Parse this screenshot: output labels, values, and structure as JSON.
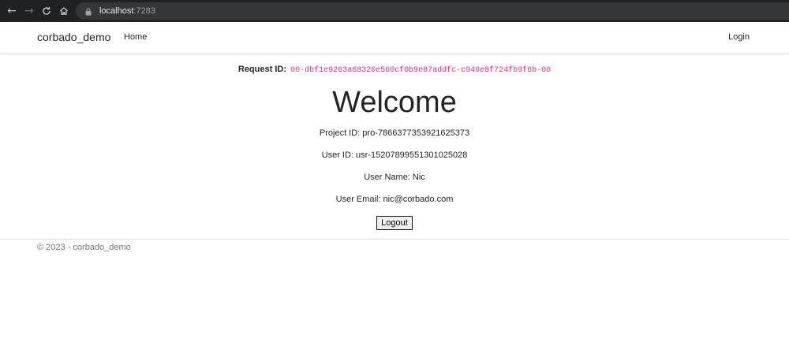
{
  "browser": {
    "back_icon": "arrow-left-icon",
    "forward_icon": "arrow-right-icon",
    "reload_icon": "reload-icon",
    "home_icon": "home-icon",
    "lock_icon": "lock-icon",
    "url_host": "localhost",
    "url_port": ":7283"
  },
  "navbar": {
    "brand": "corbado_demo",
    "home": "Home",
    "login": "Login"
  },
  "main": {
    "request_label": "Request ID:",
    "request_id": "00-dbf1e9263a68320e560cf0b9e87addfc-c949e8f724fb9f6b-00",
    "heading": "Welcome",
    "project_id": "Project ID: pro-7866377353921625373",
    "user_id": "User ID: usr-15207899551301025028",
    "user_name": "User Name: Nic",
    "user_email": "User Email: nic@corbado.com",
    "logout": "Logout"
  },
  "footer": {
    "text": "© 2023 - corbado_demo"
  },
  "colors": {
    "chrome_bg": "#202124",
    "omnibox_bg": "#35363a",
    "code_pink": "#d63384",
    "border": "#dee2e6",
    "muted": "#6c757d"
  }
}
